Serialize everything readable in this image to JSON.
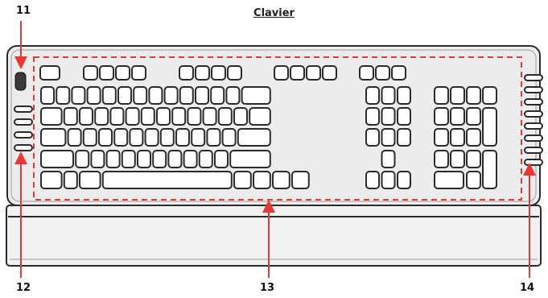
{
  "title": "Clavier",
  "callouts": [
    {
      "id": "11",
      "label": "11"
    },
    {
      "id": "12",
      "label": "12"
    },
    {
      "id": "13",
      "label": "13"
    },
    {
      "id": "14",
      "label": "14"
    }
  ],
  "colors": {
    "callout_arrow": "#e53935",
    "dashed_outline": "#e53935",
    "key_outline": "#2b2b2b",
    "key_fill": "#ffffff",
    "keyboard_body": "#e9e9e9"
  }
}
